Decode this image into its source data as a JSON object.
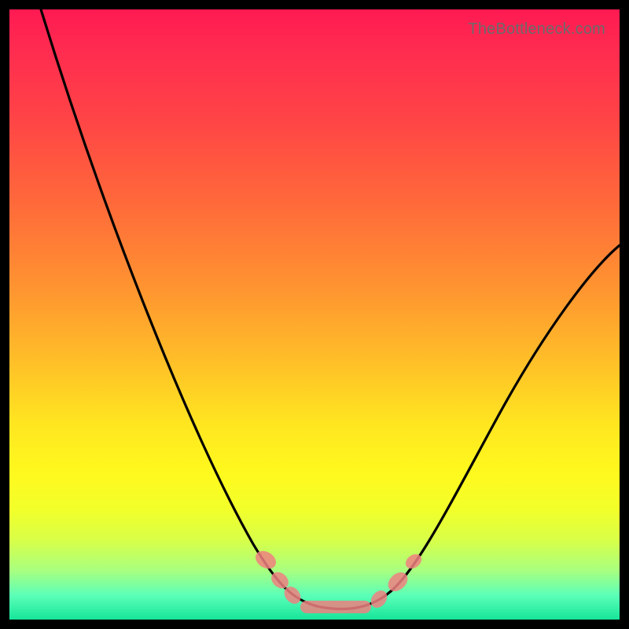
{
  "attribution": "TheBottleneck.com",
  "chart_data": {
    "type": "line",
    "title": "",
    "xlabel": "",
    "ylabel": "",
    "xlim": [
      0,
      100
    ],
    "ylim": [
      0,
      100
    ],
    "grid": false,
    "series": [
      {
        "name": "curve",
        "x": [
          5,
          10,
          15,
          20,
          25,
          30,
          35,
          40,
          45,
          48,
          50,
          52,
          55,
          58,
          60,
          63,
          66,
          70,
          75,
          80,
          85,
          90,
          95,
          100
        ],
        "values": [
          100,
          92,
          83,
          73,
          62,
          51,
          39,
          28,
          16,
          9,
          4,
          1,
          0,
          0,
          1,
          3,
          7,
          13,
          22,
          31,
          39,
          46,
          52,
          58
        ]
      }
    ],
    "markers": {
      "name": "highlight-band",
      "color": "#f08080",
      "points_x": [
        44,
        46,
        49,
        54,
        59,
        62,
        65,
        67
      ],
      "points_y": [
        13,
        9,
        3,
        0,
        0,
        2,
        6,
        10
      ]
    }
  }
}
